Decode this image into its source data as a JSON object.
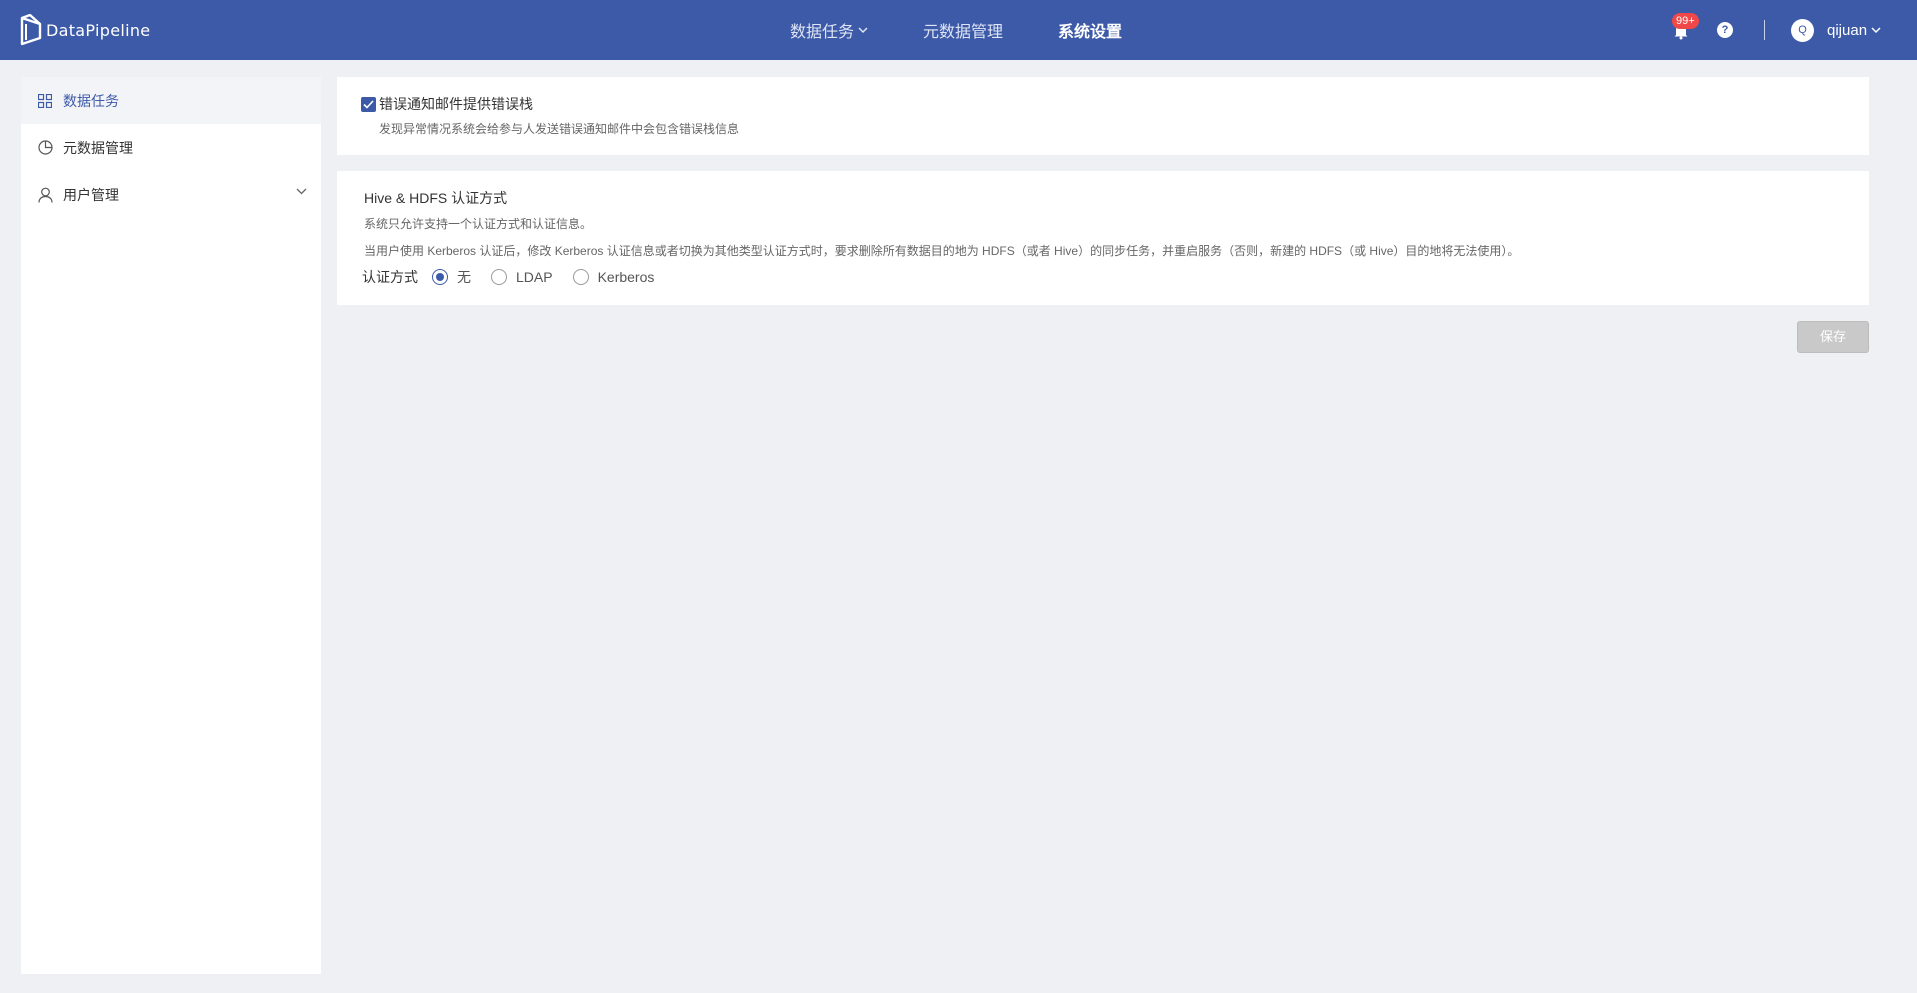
{
  "header": {
    "logo_text": "DataPipeline",
    "nav": [
      {
        "label": "数据任务",
        "has_dropdown": true
      },
      {
        "label": "元数据管理",
        "has_dropdown": false
      },
      {
        "label": "系统设置",
        "active": true
      }
    ],
    "notification_badge": "99+",
    "help_icon": "?",
    "avatar_letter": "Q",
    "username": "qijuan"
  },
  "sidebar": {
    "items": [
      {
        "label": "数据任务",
        "icon": "grid-icon",
        "active": true
      },
      {
        "label": "元数据管理",
        "icon": "pie-chart-icon"
      },
      {
        "label": "用户管理",
        "icon": "user-icon",
        "expandable": true
      }
    ]
  },
  "error_notify": {
    "checked": true,
    "label": "错误通知邮件提供错误栈",
    "description": "发现异常情况系统会给参与人发送错误通知邮件中会包含错误栈信息"
  },
  "auth": {
    "title": "Hive & HDFS 认证方式",
    "desc1": "系统只允许支持一个认证方式和认证信息。",
    "desc2": "当用户使用 Kerberos 认证后，修改 Kerberos 认证信息或者切换为其他类型认证方式时，要求删除所有数据目的地为 HDFS（或者 Hive）的同步任务，并重启服务（否则，新建的 HDFS（或 Hive）目的地将无法使用）。",
    "label": "认证方式",
    "options": [
      "无",
      "LDAP",
      "Kerberos"
    ],
    "selected": "无"
  },
  "save_button": "保存",
  "colors": {
    "primary": "#3d5aa8",
    "background": "#eff0f4",
    "badge": "#f04848",
    "disabled_button": "#c9c9c9"
  }
}
